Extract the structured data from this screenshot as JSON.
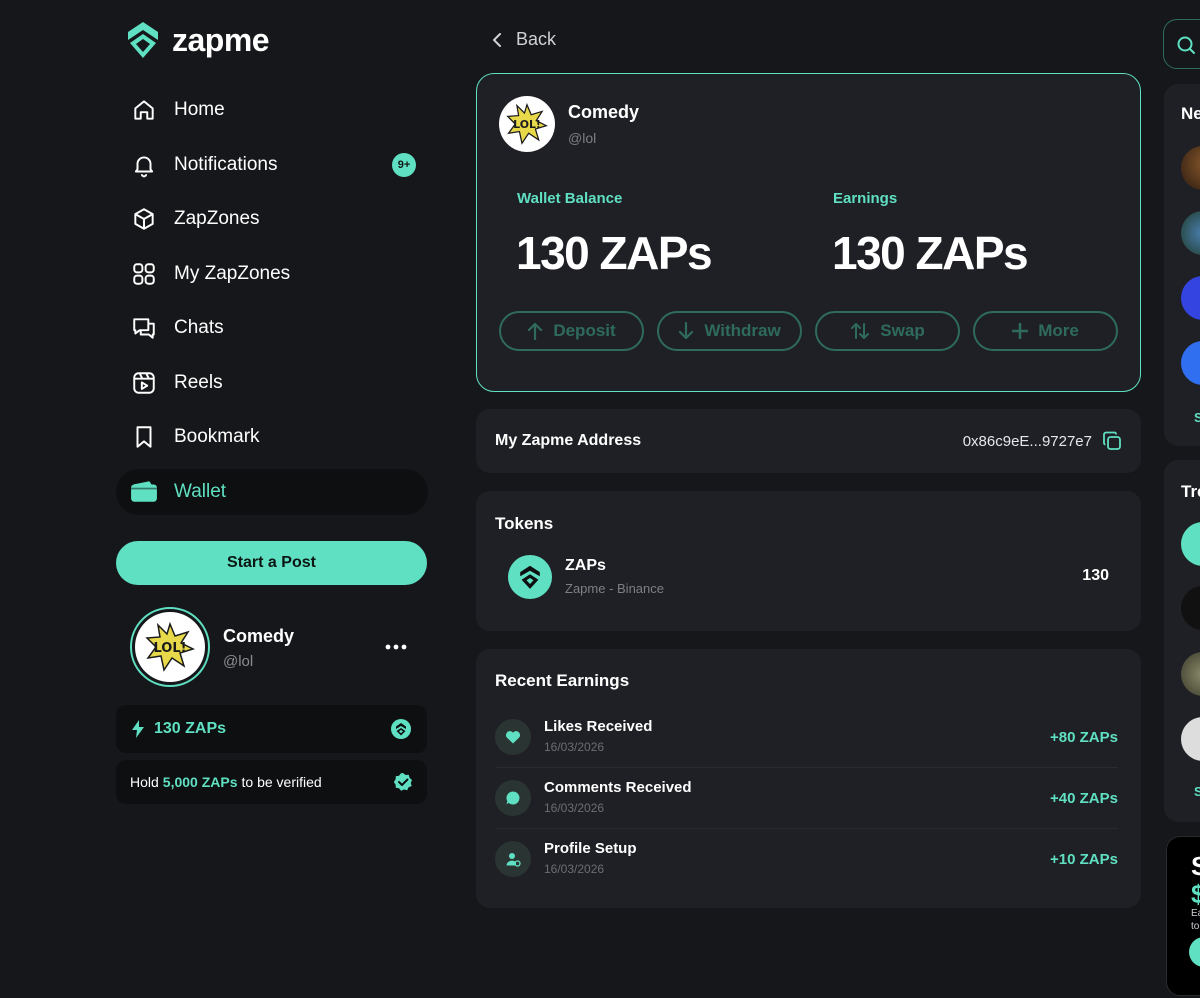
{
  "app": {
    "name": "zapme"
  },
  "colors": {
    "accent": "#5fe0c2",
    "background": "#16171b",
    "card": "#1f2025"
  },
  "sidebar": {
    "items": [
      {
        "label": "Home",
        "icon": "home-icon"
      },
      {
        "label": "Notifications",
        "icon": "bell-icon",
        "badge": "9+"
      },
      {
        "label": "ZapZones",
        "icon": "cube-icon"
      },
      {
        "label": "My ZapZones",
        "icon": "grid-icon"
      },
      {
        "label": "Chats",
        "icon": "chat-icon"
      },
      {
        "label": "Reels",
        "icon": "reels-icon"
      },
      {
        "label": "Bookmark",
        "icon": "bookmark-icon"
      },
      {
        "label": "Wallet",
        "icon": "wallet-icon",
        "active": true
      }
    ],
    "start_post_label": "Start a Post",
    "profile": {
      "name": "Comedy",
      "handle": "@lol"
    },
    "zap_balance": "130 ZAPs",
    "verify": {
      "prefix": "Hold",
      "amount": "5,000 ZAPs",
      "suffix": "to be verified"
    }
  },
  "main": {
    "back_label": "Back",
    "wallet": {
      "name": "Comedy",
      "handle": "@lol",
      "balance_label": "Wallet Balance",
      "balance_value": "130 ZAPs",
      "earnings_label": "Earnings",
      "earnings_value": "130 ZAPs",
      "buttons": [
        {
          "label": "Deposit",
          "icon": "arrow-up-icon"
        },
        {
          "label": "Withdraw",
          "icon": "arrow-down-icon"
        },
        {
          "label": "Swap",
          "icon": "swap-icon"
        },
        {
          "label": "More",
          "icon": "plus-icon"
        }
      ]
    },
    "address": {
      "title": "My Zapme Address",
      "value": "0x86c9eE...9727e7"
    },
    "tokens": {
      "title": "Tokens",
      "items": [
        {
          "name": "ZAPs",
          "network": "Zapme - Binance",
          "amount": "130"
        }
      ]
    },
    "recent_earnings": {
      "title": "Recent Earnings",
      "items": [
        {
          "name": "Likes Received",
          "date": "16/03/2026",
          "amount": "+80 ZAPs",
          "icon": "heart-icon"
        },
        {
          "name": "Comments Received",
          "date": "16/03/2026",
          "amount": "+40 ZAPs",
          "icon": "comment-icon"
        },
        {
          "name": "Profile Setup",
          "date": "16/03/2026",
          "amount": "+10 ZAPs",
          "icon": "user-icon"
        }
      ]
    }
  },
  "right": {
    "card1_title": "Ne",
    "card1_see": "S",
    "card2_title": "Tre",
    "card2_see": "S",
    "promo": {
      "line1": "S",
      "line2": "$",
      "line3": "Ea\nto"
    }
  }
}
